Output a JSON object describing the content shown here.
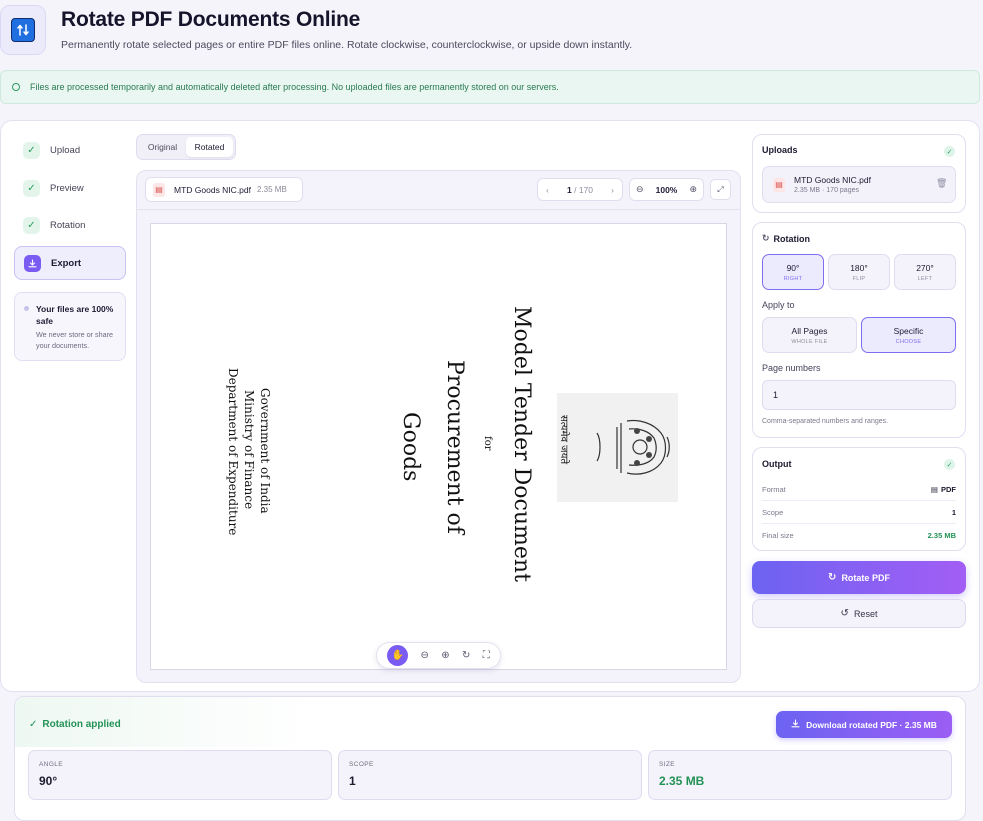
{
  "header": {
    "title": "Rotate PDF Documents Online",
    "subtitle": "Permanently rotate selected pages or entire PDF files online. Rotate clockwise, counterclockwise, or upside down instantly."
  },
  "notice": {
    "text": "Files are processed temporarily and automatically deleted after processing. No uploaded files are permanently stored on our servers."
  },
  "steps": [
    {
      "label": "Upload",
      "done": true
    },
    {
      "label": "Preview",
      "done": true
    },
    {
      "label": "Rotation",
      "done": true
    },
    {
      "label": "Export",
      "active": true
    }
  ],
  "safe_box": {
    "title": "Your files are 100% safe",
    "text": "We never store or share your documents."
  },
  "view_tabs": [
    {
      "label": "Original"
    },
    {
      "label": "Rotated",
      "selected": true
    }
  ],
  "viewer": {
    "file_name": "MTD Goods NIC.pdf",
    "file_size": "2.35 MB",
    "page_current": "1",
    "page_total": "/ 170",
    "zoom": "100%"
  },
  "document": {
    "title_line": "Model Tender Document",
    "for": "for",
    "procurement": "Procurement of",
    "goods": "Goods",
    "gov_line1": "Government of India",
    "gov_line2": "Ministry of Finance",
    "gov_line3": "Department of Expenditure",
    "emblem_text": "सत्यमेव जयते"
  },
  "uploads": {
    "title": "Uploads",
    "file_name": "MTD Goods NIC.pdf",
    "file_meta": "2.35 MB · 170 pages"
  },
  "rotation": {
    "title": "Rotation",
    "options": [
      {
        "angle": "90°",
        "label": "RIGHT",
        "selected": true
      },
      {
        "angle": "180°",
        "label": "FLIP"
      },
      {
        "angle": "270°",
        "label": "LEFT"
      }
    ],
    "apply_to_label": "Apply to",
    "apply_options": [
      {
        "label": "All Pages",
        "sub": "WHOLE FILE"
      },
      {
        "label": "Specific",
        "sub": "CHOOSE",
        "selected": true
      }
    ],
    "page_numbers_label": "Page numbers",
    "page_numbers_value": "1",
    "page_numbers_hint": "Comma-separated numbers and ranges."
  },
  "output": {
    "title": "Output",
    "rows": [
      {
        "key": "Format",
        "value": "PDF"
      },
      {
        "key": "Scope",
        "value": "1"
      },
      {
        "key": "Final size",
        "value": "2.35 MB"
      }
    ]
  },
  "actions": {
    "rotate": "Rotate PDF",
    "reset": "Reset"
  },
  "result": {
    "status": "Rotation applied",
    "download": "Download rotated PDF · 2.35 MB",
    "stats": [
      {
        "key": "ANGLE",
        "value": "90°"
      },
      {
        "key": "SCOPE",
        "value": "1"
      },
      {
        "key": "SIZE",
        "value": "2.35 MB"
      }
    ]
  },
  "colors": {
    "accent": "#7b5cf2",
    "success": "#239257"
  }
}
